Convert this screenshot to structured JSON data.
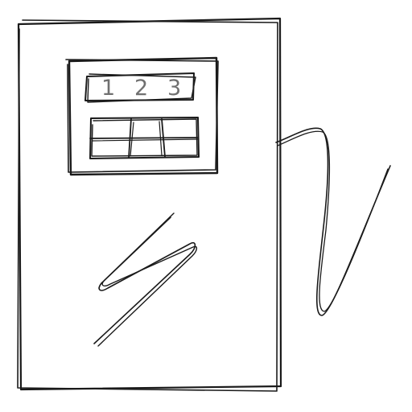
{
  "display": {
    "digits": [
      "1",
      "2",
      "3"
    ]
  },
  "keypad": {
    "rows": 2,
    "columns": 3
  },
  "colors": {
    "ink": "#1a1a1a",
    "display_text": "#707070",
    "background": "#ffffff"
  },
  "icons": {
    "decoration": "lightning-squiggle",
    "cable": "power-cord"
  }
}
